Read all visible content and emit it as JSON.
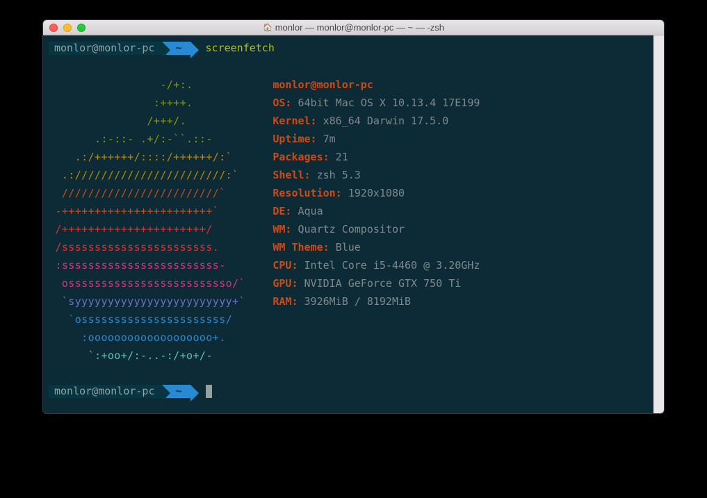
{
  "window": {
    "title": "monlor — monlor@monlor-pc — ~ — -zsh"
  },
  "prompt": {
    "host": "monlor@monlor-pc",
    "path": "~",
    "command": "screenfetch"
  },
  "ascii": {
    "l1": "                 -/+:.         ",
    "l2": "                :++++.         ",
    "l3": "               /+++/.          ",
    "l4": "       .:-::- .+/:-``.::-      ",
    "l5": "    .:/++++++/::::/++++++/:`   ",
    "l6": "  .:///////////////////////:`  ",
    "l7": "  ////////////////////////`    ",
    "l8": " -+++++++++++++++++++++++`     ",
    "l9": " /++++++++++++++++++++++/      ",
    "l10": " /sssssssssssssssssssssss.     ",
    "l11": " :ssssssssssssssssssssssss-    ",
    "l12": "  osssssssssssssssssssssssso/` ",
    "l13": "  `syyyyyyyyyyyyyyyyyyyyyyyy+` ",
    "l14": "   `ossssssssssssssssssssss/   ",
    "l15": "     :ooooooooooooooooooo+.    ",
    "l16": "      `:+oo+/:-..-:/+o+/-      "
  },
  "info": {
    "user_host": "monlor@monlor-pc",
    "os_label": "OS:",
    "os_value": "64bit Mac OS X 10.13.4 17E199",
    "kernel_label": "Kernel:",
    "kernel_value": "x86_64 Darwin 17.5.0",
    "uptime_label": "Uptime:",
    "uptime_value": "7m",
    "packages_label": "Packages:",
    "packages_value": "21",
    "shell_label": "Shell:",
    "shell_value": "zsh 5.3",
    "resolution_label": "Resolution:",
    "resolution_value": "1920x1080",
    "de_label": "DE:",
    "de_value": "Aqua",
    "wm_label": "WM:",
    "wm_value": "Quartz Compositor",
    "wmtheme_label": "WM Theme:",
    "wmtheme_value": "Blue",
    "cpu_label": "CPU:",
    "cpu_value": "Intel Core i5-4460 @ 3.20GHz",
    "gpu_label": "GPU:",
    "gpu_value": "NVIDIA GeForce GTX 750 Ti",
    "ram_label": "RAM:",
    "ram_value": "3926MiB / 8192MiB"
  }
}
